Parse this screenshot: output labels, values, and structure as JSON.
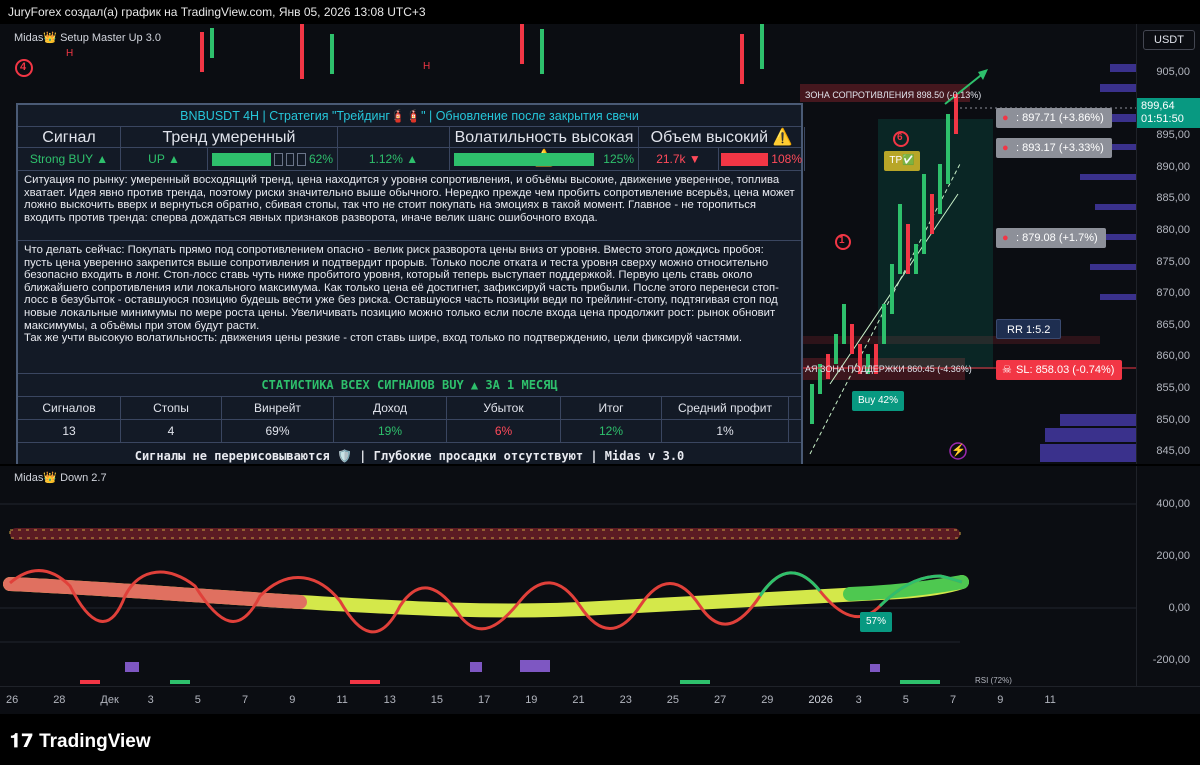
{
  "header": {
    "title": "JuryForex создал(а) график на TradingView.com, Янв 05, 2026 13:08 UTC+3"
  },
  "indicators": {
    "main": "Midas👑 Setup Master Up 3.0",
    "osc": "Midas👑 Down 2.7"
  },
  "price_axis": {
    "currency": "USDT",
    "current_price": "899,64",
    "countdown": "01:51:50",
    "ticks": [
      "905,00",
      "900,00",
      "895,00",
      "890,00",
      "885,00",
      "880,00",
      "875,00",
      "870,00",
      "865,00",
      "860,00",
      "855,00",
      "850,00",
      "845,00"
    ]
  },
  "osc_axis": {
    "ticks": [
      "400,00",
      "200,00",
      "0,00",
      "-200,00"
    ]
  },
  "time_axis": {
    "labels": [
      "26",
      "28",
      "Дек",
      "3",
      "5",
      "7",
      "9",
      "11",
      "13",
      "15",
      "17",
      "19",
      "21",
      "23",
      "25",
      "27",
      "29",
      "2026",
      "3",
      "5",
      "7",
      "9",
      "11"
    ]
  },
  "panel": {
    "title": "BNBUSDT 4H | Стратегия \"Трейдинг🧯🧯\" | Обновление после закрытия свечи",
    "headers": [
      "Сигнал",
      "Тренд умеренный",
      "Волатильность высокая ⚠️",
      "",
      "Объем высокий ⚠️"
    ],
    "signal": "Strong BUY ▲",
    "trend": "UP ▲",
    "trend_pct": "62%",
    "trend_fill": 0.62,
    "vol_value": "1.12% ▲",
    "vol_pct": "125%",
    "volume_value": "21.7k ▼",
    "volume_pct": "108%",
    "situation": "Ситуация по рынку: умеренный восходящий тренд, цена находится у уровня сопротивления, и объёмы высокие, движение уверенное, топлива хватает. Идея явно против тренда, поэтому риски значительно выше обычного. Нередко прежде чем пробить сопротивление всерьёз, цена может ложно выскочить вверх и вернуться обратно, сбивая стопы, так что не стоит покупать на эмоциях в такой момент. Главное - не торопиться входить против тренда: сперва дождаться явных признаков разворота, иначе велик шанс ошибочного входа.",
    "todo": "Что делать сейчас: Покупать прямо под сопротивлением опасно - велик риск разворота цены вниз от уровня. Вместо этого дождись пробоя: пусть цена уверенно закрепится выше сопротивления и подтвердит прорыв. Только после отката и теста уровня сверху можно относительно безопасно входить в лонг. Стоп-лосс ставь чуть ниже пробитого уровня, который теперь выступает поддержкой. Первую цель ставь около ближайшего сопротивления или локального максимума. Как только цена её достигнет, зафиксируй часть прибыли. После этого перенеси стоп-лосс в безубыток - оставшуюся позицию будешь вести уже без риска. Оставшуюся часть позиции веди по трейлинг-стопу, подтягивая стоп под новые локальные минимумы по мере роста цены. Увеличивать позицию можно только если после входа цена продолжит рост: рынок обновит максимумы, а объёмы при этом будут расти.",
    "todo2": "Так же учти высокую волатильность: движения цены резкие - стоп ставь шире, вход только по подтверждению, цели фиксируй частями.",
    "stats_title": "СТАТИСТИКА ВСЕХ СИГНАЛОВ BUY ▲ ЗА 1 МЕСЯЦ",
    "stats_headers": [
      "Сигналов",
      "Стопы",
      "Винрейт",
      "Доход",
      "Убыток",
      "Итог",
      "Средний профит"
    ],
    "stats_values": [
      "13",
      "4",
      "69%",
      "19%",
      "6%",
      "12%",
      "1%"
    ],
    "footer": "Сигналы не перерисовываются 🛡️ | Глубокие просадки отсутствуют | Midas v 3.0"
  },
  "chart_tags": {
    "tp1": ": 897.71 (+3.86%)",
    "tp2": ": 893.17 (+3.33%)",
    "tp3": ": 879.08 (+1.7%)",
    "rr": "RR 1:5.2",
    "sl": "SL: 858.03 (-0.74%)",
    "resistance": "ЗОНА СОПРОТИВЛЕНИЯ 898.50 (-0.13%)",
    "support": "АЯ ЗОНА ПОДДЕРЖКИ 860.45 (-4.36%)",
    "buy": "Buy 42%",
    "tp": "TP✅",
    "osc_pct": "57%",
    "marker4": "4",
    "marker1": "1",
    "marker6": "6",
    "h1": "H",
    "h2": "H",
    "rsi": "RSI (72%)"
  },
  "brand": {
    "name": "TradingView"
  }
}
